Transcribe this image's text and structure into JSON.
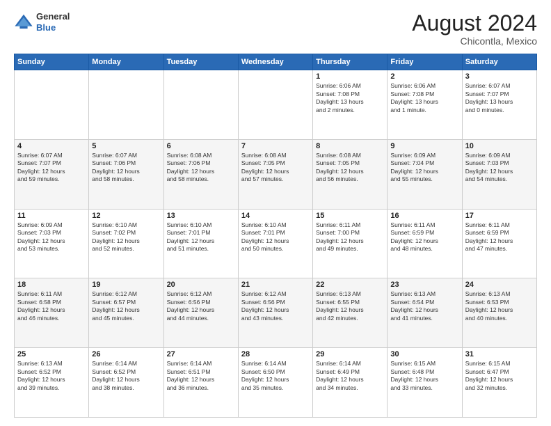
{
  "header": {
    "logo": {
      "general": "General",
      "blue": "Blue"
    },
    "title": "August 2024",
    "location": "Chicontla, Mexico"
  },
  "calendar": {
    "days_of_week": [
      "Sunday",
      "Monday",
      "Tuesday",
      "Wednesday",
      "Thursday",
      "Friday",
      "Saturday"
    ],
    "weeks": [
      [
        {
          "day": "",
          "info": ""
        },
        {
          "day": "",
          "info": ""
        },
        {
          "day": "",
          "info": ""
        },
        {
          "day": "",
          "info": ""
        },
        {
          "day": "1",
          "info": "Sunrise: 6:06 AM\nSunset: 7:08 PM\nDaylight: 13 hours\nand 2 minutes."
        },
        {
          "day": "2",
          "info": "Sunrise: 6:06 AM\nSunset: 7:08 PM\nDaylight: 13 hours\nand 1 minute."
        },
        {
          "day": "3",
          "info": "Sunrise: 6:07 AM\nSunset: 7:07 PM\nDaylight: 13 hours\nand 0 minutes."
        }
      ],
      [
        {
          "day": "4",
          "info": "Sunrise: 6:07 AM\nSunset: 7:07 PM\nDaylight: 12 hours\nand 59 minutes."
        },
        {
          "day": "5",
          "info": "Sunrise: 6:07 AM\nSunset: 7:06 PM\nDaylight: 12 hours\nand 58 minutes."
        },
        {
          "day": "6",
          "info": "Sunrise: 6:08 AM\nSunset: 7:06 PM\nDaylight: 12 hours\nand 58 minutes."
        },
        {
          "day": "7",
          "info": "Sunrise: 6:08 AM\nSunset: 7:05 PM\nDaylight: 12 hours\nand 57 minutes."
        },
        {
          "day": "8",
          "info": "Sunrise: 6:08 AM\nSunset: 7:05 PM\nDaylight: 12 hours\nand 56 minutes."
        },
        {
          "day": "9",
          "info": "Sunrise: 6:09 AM\nSunset: 7:04 PM\nDaylight: 12 hours\nand 55 minutes."
        },
        {
          "day": "10",
          "info": "Sunrise: 6:09 AM\nSunset: 7:03 PM\nDaylight: 12 hours\nand 54 minutes."
        }
      ],
      [
        {
          "day": "11",
          "info": "Sunrise: 6:09 AM\nSunset: 7:03 PM\nDaylight: 12 hours\nand 53 minutes."
        },
        {
          "day": "12",
          "info": "Sunrise: 6:10 AM\nSunset: 7:02 PM\nDaylight: 12 hours\nand 52 minutes."
        },
        {
          "day": "13",
          "info": "Sunrise: 6:10 AM\nSunset: 7:01 PM\nDaylight: 12 hours\nand 51 minutes."
        },
        {
          "day": "14",
          "info": "Sunrise: 6:10 AM\nSunset: 7:01 PM\nDaylight: 12 hours\nand 50 minutes."
        },
        {
          "day": "15",
          "info": "Sunrise: 6:11 AM\nSunset: 7:00 PM\nDaylight: 12 hours\nand 49 minutes."
        },
        {
          "day": "16",
          "info": "Sunrise: 6:11 AM\nSunset: 6:59 PM\nDaylight: 12 hours\nand 48 minutes."
        },
        {
          "day": "17",
          "info": "Sunrise: 6:11 AM\nSunset: 6:59 PM\nDaylight: 12 hours\nand 47 minutes."
        }
      ],
      [
        {
          "day": "18",
          "info": "Sunrise: 6:11 AM\nSunset: 6:58 PM\nDaylight: 12 hours\nand 46 minutes."
        },
        {
          "day": "19",
          "info": "Sunrise: 6:12 AM\nSunset: 6:57 PM\nDaylight: 12 hours\nand 45 minutes."
        },
        {
          "day": "20",
          "info": "Sunrise: 6:12 AM\nSunset: 6:56 PM\nDaylight: 12 hours\nand 44 minutes."
        },
        {
          "day": "21",
          "info": "Sunrise: 6:12 AM\nSunset: 6:56 PM\nDaylight: 12 hours\nand 43 minutes."
        },
        {
          "day": "22",
          "info": "Sunrise: 6:13 AM\nSunset: 6:55 PM\nDaylight: 12 hours\nand 42 minutes."
        },
        {
          "day": "23",
          "info": "Sunrise: 6:13 AM\nSunset: 6:54 PM\nDaylight: 12 hours\nand 41 minutes."
        },
        {
          "day": "24",
          "info": "Sunrise: 6:13 AM\nSunset: 6:53 PM\nDaylight: 12 hours\nand 40 minutes."
        }
      ],
      [
        {
          "day": "25",
          "info": "Sunrise: 6:13 AM\nSunset: 6:52 PM\nDaylight: 12 hours\nand 39 minutes."
        },
        {
          "day": "26",
          "info": "Sunrise: 6:14 AM\nSunset: 6:52 PM\nDaylight: 12 hours\nand 38 minutes."
        },
        {
          "day": "27",
          "info": "Sunrise: 6:14 AM\nSunset: 6:51 PM\nDaylight: 12 hours\nand 36 minutes."
        },
        {
          "day": "28",
          "info": "Sunrise: 6:14 AM\nSunset: 6:50 PM\nDaylight: 12 hours\nand 35 minutes."
        },
        {
          "day": "29",
          "info": "Sunrise: 6:14 AM\nSunset: 6:49 PM\nDaylight: 12 hours\nand 34 minutes."
        },
        {
          "day": "30",
          "info": "Sunrise: 6:15 AM\nSunset: 6:48 PM\nDaylight: 12 hours\nand 33 minutes."
        },
        {
          "day": "31",
          "info": "Sunrise: 6:15 AM\nSunset: 6:47 PM\nDaylight: 12 hours\nand 32 minutes."
        }
      ]
    ]
  }
}
